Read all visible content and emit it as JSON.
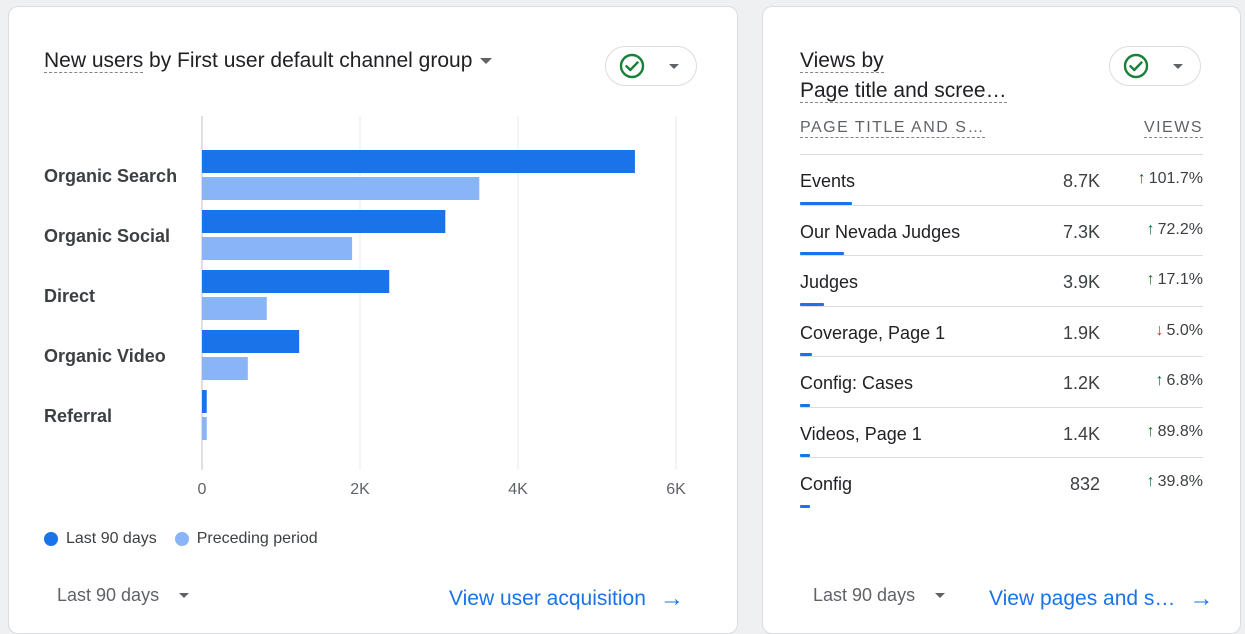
{
  "acquisition_card": {
    "title_part1": "New users",
    "title_part2": " by First user default channel group",
    "footer_date": "Last 90 days",
    "footer_link": "View user acquisition"
  },
  "chart_data": {
    "type": "bar",
    "orientation": "horizontal",
    "categories": [
      "Organic Search",
      "Organic Social",
      "Direct",
      "Organic Video",
      "Referral"
    ],
    "series": [
      {
        "name": "Last 90 days",
        "color": "#1a73e8",
        "values": [
          5480,
          3080,
          2370,
          1230,
          60
        ]
      },
      {
        "name": "Preceding period",
        "color": "#8ab4f8",
        "values": [
          3510,
          1900,
          820,
          580,
          60
        ]
      }
    ],
    "xlim": [
      0,
      6000
    ],
    "x_ticks": [
      0,
      2000,
      4000,
      6000
    ],
    "x_tick_labels": [
      "0",
      "2K",
      "4K",
      "6K"
    ],
    "grid": true,
    "legend_position": "bottom-left"
  },
  "pages_card": {
    "title_line1": "Views by",
    "title_line2": "Page title and scree…",
    "col1_header": "PAGE TITLE AND S…",
    "col2_header": "VIEWS",
    "footer_date": "Last 90 days",
    "footer_link": "View pages and s…",
    "rows": [
      {
        "name": "Events",
        "views": "8.7K",
        "change": "101.7%",
        "direction": "up",
        "share": 0.13
      },
      {
        "name": "Our Nevada Judges",
        "views": "7.3K",
        "change": "72.2%",
        "direction": "up",
        "share": 0.11
      },
      {
        "name": "Judges",
        "views": "3.9K",
        "change": "17.1%",
        "direction": "up",
        "share": 0.06
      },
      {
        "name": "Coverage, Page 1",
        "views": "1.9K",
        "change": "5.0%",
        "direction": "down",
        "share": 0.03
      },
      {
        "name": "Config: Cases",
        "views": "1.2K",
        "change": "6.8%",
        "direction": "up",
        "share": 0.02
      },
      {
        "name": "Videos, Page 1",
        "views": "1.4K",
        "change": "89.8%",
        "direction": "up",
        "share": 0.02
      },
      {
        "name": "Config",
        "views": "832",
        "change": "39.8%",
        "direction": "up",
        "share": 0.01
      }
    ]
  },
  "colors": {
    "accent": "#1a73e8",
    "accent_light": "#8ab4f8",
    "up": "#137333",
    "down": "#d93025",
    "check": "#188038"
  }
}
